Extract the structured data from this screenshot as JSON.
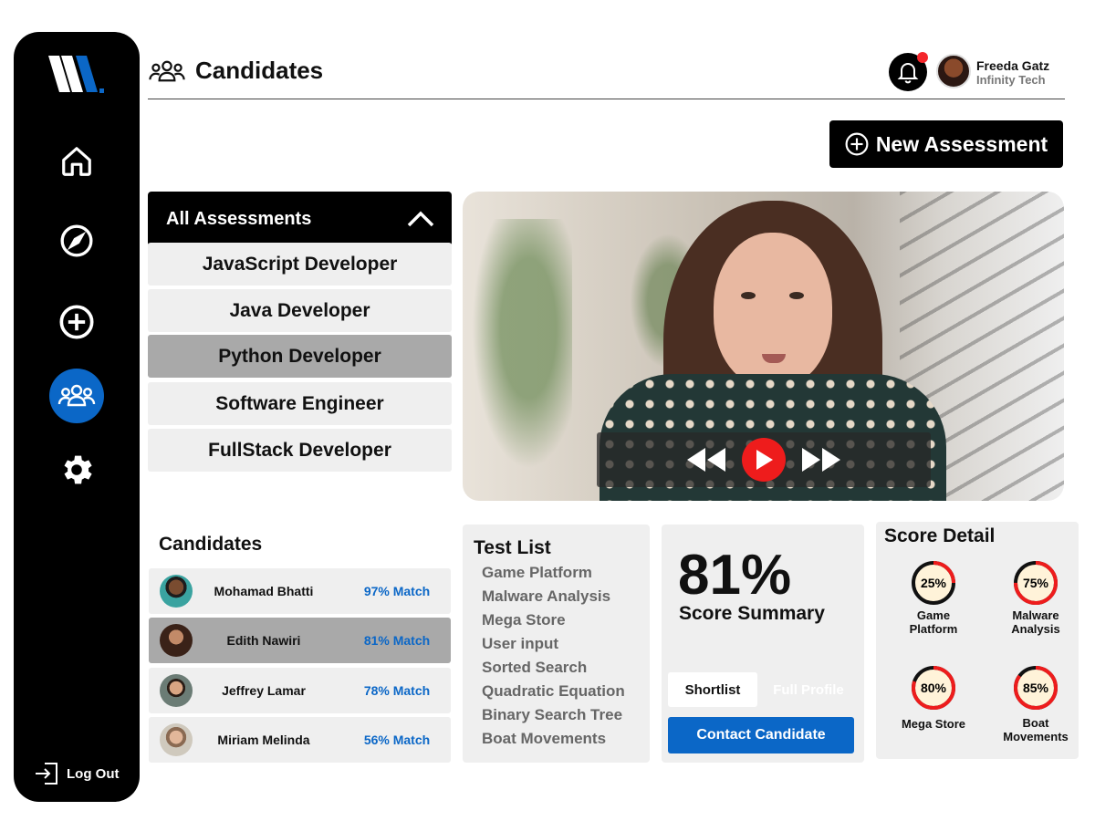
{
  "app": {
    "logo": "W"
  },
  "sidebar": {
    "nav": [
      {
        "name": "home-icon"
      },
      {
        "name": "compass-icon"
      },
      {
        "name": "plus-circle-icon"
      },
      {
        "name": "candidates-icon"
      },
      {
        "name": "gear-icon"
      }
    ],
    "logout_label": "Log Out"
  },
  "header": {
    "title": "Candidates",
    "user": {
      "name": "Freeda Gatz",
      "company": "Infinity Tech"
    }
  },
  "actions": {
    "new_assessment_label": "New Assessment"
  },
  "assessments": {
    "header_label": "All Assessments",
    "items": [
      {
        "label": "JavaScript Developer"
      },
      {
        "label": "Java Developer"
      },
      {
        "label": "Python Developer"
      },
      {
        "label": "Software Engineer"
      },
      {
        "label": "FullStack Developer"
      }
    ],
    "selected": "Python Developer"
  },
  "candidates": {
    "title": "Candidates",
    "rows": [
      {
        "name": "Mohamad Bhatti",
        "match": "97% Match"
      },
      {
        "name": "Edith Nawiri",
        "match": "81% Match"
      },
      {
        "name": "Jeffrey Lamar",
        "match": "78% Match"
      },
      {
        "name": "Miriam Melinda",
        "match": "56% Match"
      }
    ],
    "selected": "Edith Nawiri"
  },
  "test_list": {
    "title": "Test List",
    "items": [
      "Game Platform",
      "Malware Analysis",
      "Mega Store",
      "User input",
      "Sorted Search",
      "Quadratic Equation",
      "Binary Search Tree",
      "Boat Movements"
    ]
  },
  "score_summary": {
    "score": "81%",
    "label": "Score Summary",
    "shortlist_label": "Shortlist",
    "full_profile_label": "Full Profile",
    "contact_label": "Contact Candidate"
  },
  "score_detail": {
    "title": "Score Detail",
    "items": [
      {
        "label_line1": "Game",
        "label_line2": "Platform",
        "value": "25%",
        "fraction": 0.25
      },
      {
        "label_line1": "Malware",
        "label_line2": "Analysis",
        "value": "75%",
        "fraction": 0.75
      },
      {
        "label_line1": "Mega Store",
        "label_line2": "",
        "value": "80%",
        "fraction": 0.8
      },
      {
        "label_line1": "Boat",
        "label_line2": "Movements",
        "value": "85%",
        "fraction": 0.85
      }
    ]
  },
  "colors": {
    "accent": "#0b67c7",
    "danger": "#ee1c1c",
    "panel": "#efefef",
    "selected": "#a9a9a9"
  }
}
